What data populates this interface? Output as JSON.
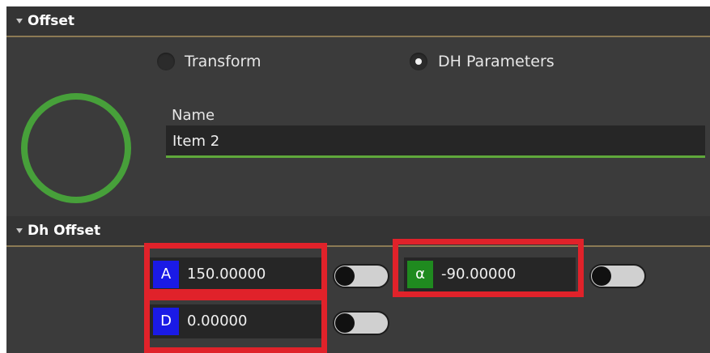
{
  "offset_section": {
    "title": "Offset"
  },
  "mode": {
    "options": [
      {
        "label": "Transform",
        "selected": false
      },
      {
        "label": "DH Parameters",
        "selected": true
      }
    ]
  },
  "name": {
    "label": "Name",
    "value": "Item 2"
  },
  "dh_section": {
    "title": "Dh Offset"
  },
  "dh_params": {
    "a": {
      "tag": "A",
      "value": "150.00000",
      "tag_color": "#1a1ae6",
      "toggle_on": false
    },
    "alpha": {
      "tag": "α",
      "value": "-90.00000",
      "tag_color": "#1f8a1f",
      "toggle_on": false
    },
    "d": {
      "tag": "D",
      "value": "0.00000",
      "tag_color": "#1a1ae6",
      "toggle_on": false
    }
  },
  "colors": {
    "highlight": "#e0222a",
    "accent_green": "#5fa83b",
    "header_rule": "#8c7a54"
  },
  "icons": {
    "object_icon": "circle-outline-icon"
  }
}
